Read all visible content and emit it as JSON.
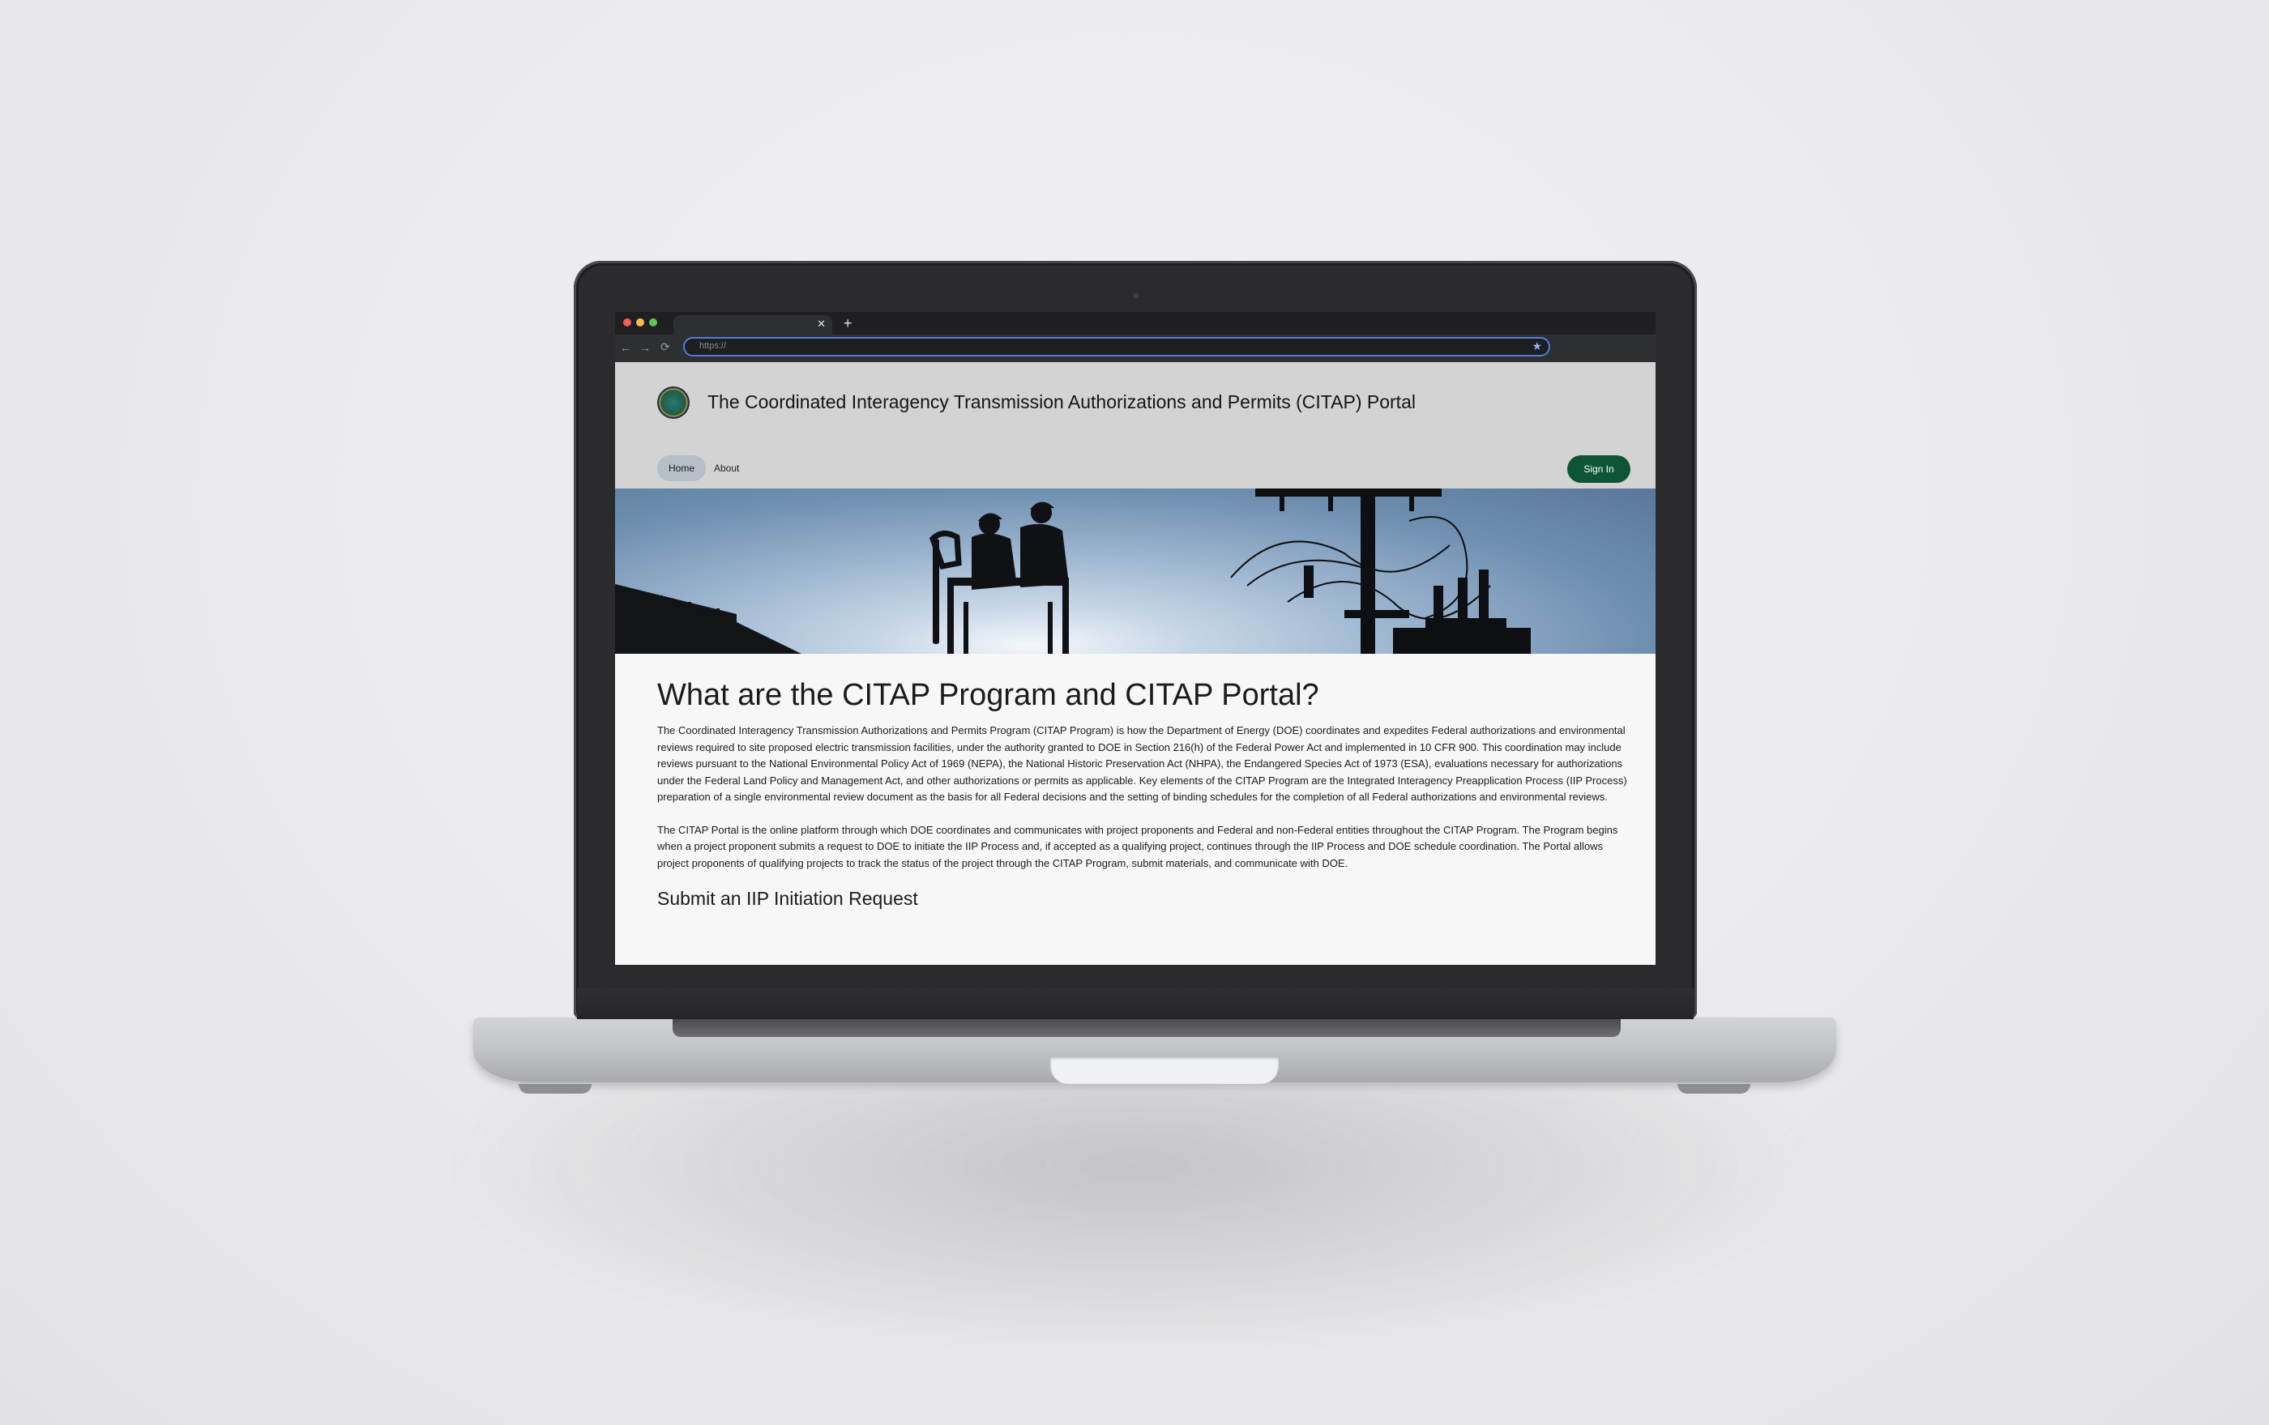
{
  "browser": {
    "url": "https://",
    "tab_close": "✕",
    "new_tab": "+",
    "back_icon": "←",
    "forward_icon": "→",
    "reload_icon": "⟳",
    "bookmark_icon": "★"
  },
  "site": {
    "title": "The Coordinated Interagency Transmission Authorizations and Permits (CITAP) Portal",
    "nav": {
      "home": "Home",
      "about": "About"
    },
    "sign_in": "Sign In"
  },
  "main": {
    "heading": "What are the CITAP Program and CITAP Portal?",
    "paragraph1": "The Coordinated Interagency Transmission Authorizations and Permits Program (CITAP Program) is how the Department of Energy (DOE) coordinates and expedites Federal authorizations and environmental reviews required to site proposed electric transmission facilities, under the authority granted to DOE in Section 216(h) of the Federal Power Act and implemented in 10 CFR 900. This coordination may include reviews pursuant to the National Environmental Policy Act of 1969 (NEPA), the National Historic Preservation Act (NHPA), the Endangered Species Act of 1973 (ESA), evaluations necessary for authorizations under the Federal Land Policy and Management Act, and other authorizations or permits as applicable. Key elements of the CITAP Program are the Integrated Interagency Preapplication Process (IIP Process) preparation of a single environmental review document as the basis for all Federal decisions and the setting of binding schedules for the completion of all Federal authorizations and environmental reviews.",
    "paragraph2": "The CITAP Portal is the online platform through which DOE coordinates and communicates with project proponents and Federal and non-Federal entities throughout the CITAP Program. The Program begins when a project proponent submits a request to DOE to initiate the IIP Process and, if accepted as a qualifying project, continues through the IIP Process and DOE schedule coordination. The Portal allows project proponents of qualifying projects to track the status of the project through the CITAP Program, submit materials, and communicate with DOE.",
    "subheading": "Submit an IIP Initiation Request"
  },
  "colors": {
    "sign_in_bg": "#0d5535",
    "header_bg": "#d3d3d4",
    "nav_active_bg": "#b6bec8",
    "omnibox_border": "#4f7fd9"
  }
}
